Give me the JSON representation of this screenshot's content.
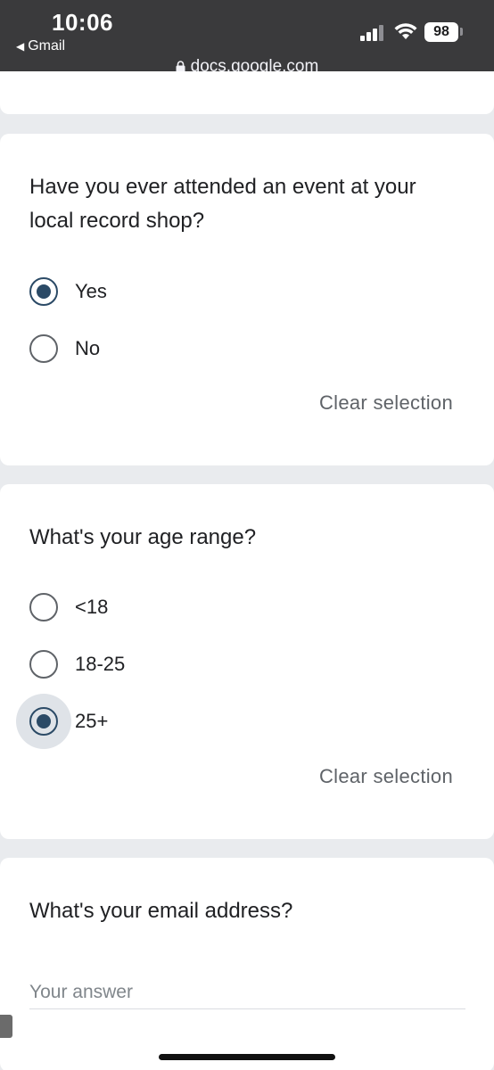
{
  "status_bar": {
    "time": "10:06",
    "back_app": "Gmail",
    "battery": "98",
    "url": "docs.google.com"
  },
  "questions": [
    {
      "title": "Have you ever attended an event at your local record shop?",
      "options": [
        {
          "label": "Yes",
          "selected": true
        },
        {
          "label": "No",
          "selected": false
        }
      ],
      "clear_label": "Clear selection"
    },
    {
      "title": "What's your age range?",
      "options": [
        {
          "label": "<18",
          "selected": false
        },
        {
          "label": "18-25",
          "selected": false
        },
        {
          "label": "25+",
          "selected": true
        }
      ],
      "clear_label": "Clear selection"
    },
    {
      "title": "What's your email address?",
      "placeholder": "Your answer",
      "value": ""
    }
  ],
  "colors": {
    "accent": "#2b4a66",
    "status_bar_bg": "#3a3a3c",
    "page_bg": "#e9ebee",
    "card_bg": "#ffffff"
  }
}
